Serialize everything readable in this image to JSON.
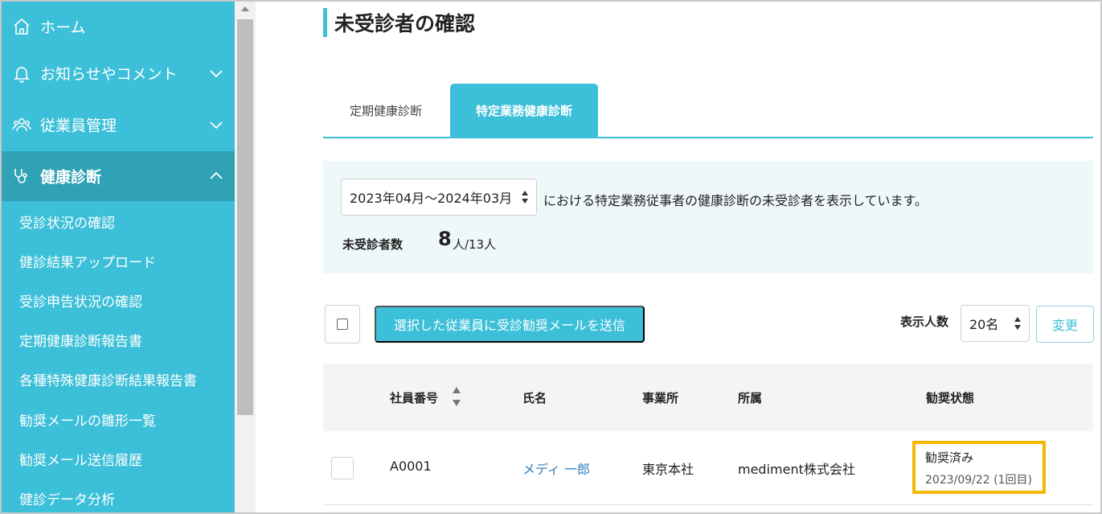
{
  "sidebar": {
    "items": [
      {
        "label": "ホーム",
        "icon": "home-icon"
      },
      {
        "label": "お知らせやコメント",
        "icon": "bell-icon"
      },
      {
        "label": "従業員管理",
        "icon": "users-icon"
      },
      {
        "label": "健康診断",
        "icon": "stethoscope-icon"
      }
    ],
    "sub_items": [
      "受診状況の確認",
      "健診結果アップロード",
      "受診申告状況の確認",
      "定期健康診断報告書",
      "各種特殊健康診断結果報告書",
      "勧奨メールの雛形一覧",
      "勧奨メール送信履歴",
      "健診データ分析"
    ]
  },
  "page": {
    "title": "未受診者の確認"
  },
  "tabs": [
    {
      "label": "定期健康診断",
      "active": false
    },
    {
      "label": "特定業務健康診断",
      "active": true
    }
  ],
  "info": {
    "period_value": "2023年04月〜2024年03月",
    "description": "における特定業務従事者の健康診断の未受診者を表示しています。",
    "count_label": "未受診者数",
    "count_value": "8",
    "count_suffix": "人/13人"
  },
  "actions": {
    "send_label": "選択した従業員に受診勧奨メールを送信",
    "per_page_label": "表示人数",
    "per_page_value": "20名",
    "change_label": "変更"
  },
  "table": {
    "headers": [
      "社員番号",
      "氏名",
      "事業所",
      "所属",
      "勧奨状態"
    ],
    "rows": [
      {
        "id": "A0001",
        "name": "メディ 一郎",
        "office": "東京本社",
        "department": "mediment株式会社",
        "status": "勧奨済み",
        "status_date": "2023/09/22 (1回目)"
      }
    ]
  },
  "colors": {
    "accent": "#3cbfd8",
    "highlight": "#f5b800",
    "link": "#2f7fc1"
  }
}
